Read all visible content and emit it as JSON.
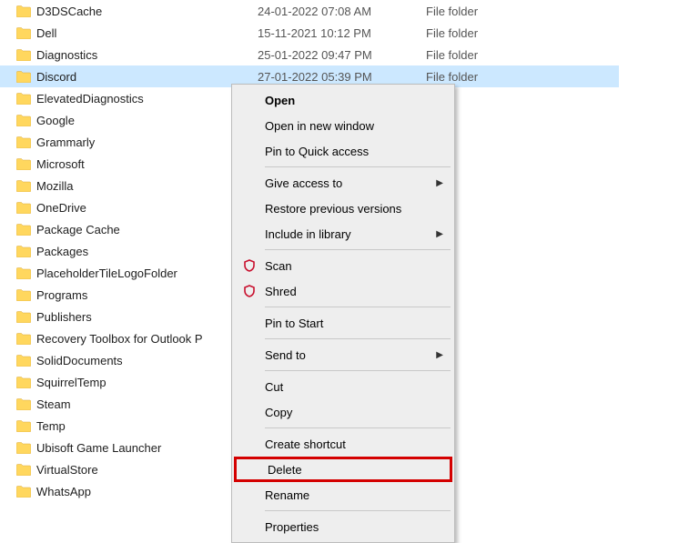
{
  "rows": [
    {
      "name": "D3DSCache",
      "date": "24-01-2022 07:08 AM",
      "type": "File folder",
      "selected": false
    },
    {
      "name": "Dell",
      "date": "15-11-2021 10:12 PM",
      "type": "File folder",
      "selected": false
    },
    {
      "name": "Diagnostics",
      "date": "25-01-2022 09:47 PM",
      "type": "File folder",
      "selected": false
    },
    {
      "name": "Discord",
      "date": "27-01-2022 05:39 PM",
      "type": "File folder",
      "selected": true
    },
    {
      "name": "ElevatedDiagnostics",
      "date": "",
      "type": "older",
      "selected": false
    },
    {
      "name": "Google",
      "date": "",
      "type": "older",
      "selected": false
    },
    {
      "name": "Grammarly",
      "date": "",
      "type": "older",
      "selected": false
    },
    {
      "name": "Microsoft",
      "date": "",
      "type": "older",
      "selected": false
    },
    {
      "name": "Mozilla",
      "date": "",
      "type": "older",
      "selected": false
    },
    {
      "name": "OneDrive",
      "date": "",
      "type": "older",
      "selected": false
    },
    {
      "name": "Package Cache",
      "date": "",
      "type": "older",
      "selected": false
    },
    {
      "name": "Packages",
      "date": "",
      "type": "older",
      "selected": false
    },
    {
      "name": "PlaceholderTileLogoFolder",
      "date": "",
      "type": "older",
      "selected": false
    },
    {
      "name": "Programs",
      "date": "",
      "type": "older",
      "selected": false
    },
    {
      "name": "Publishers",
      "date": "",
      "type": "older",
      "selected": false
    },
    {
      "name": "Recovery Toolbox for Outlook P",
      "date": "",
      "type": "older",
      "selected": false
    },
    {
      "name": "SolidDocuments",
      "date": "",
      "type": "older",
      "selected": false
    },
    {
      "name": "SquirrelTemp",
      "date": "",
      "type": "older",
      "selected": false
    },
    {
      "name": "Steam",
      "date": "",
      "type": "older",
      "selected": false
    },
    {
      "name": "Temp",
      "date": "",
      "type": "older",
      "selected": false
    },
    {
      "name": "Ubisoft Game Launcher",
      "date": "",
      "type": "older",
      "selected": false
    },
    {
      "name": "VirtualStore",
      "date": "",
      "type": "older",
      "selected": false
    },
    {
      "name": "WhatsApp",
      "date": "",
      "type": "older",
      "selected": false
    }
  ],
  "menu": {
    "open": "Open",
    "open_new_window": "Open in new window",
    "pin_quick_access": "Pin to Quick access",
    "give_access_to": "Give access to",
    "restore_previous": "Restore previous versions",
    "include_in_library": "Include in library",
    "scan": "Scan",
    "shred": "Shred",
    "pin_to_start": "Pin to Start",
    "send_to": "Send to",
    "cut": "Cut",
    "copy": "Copy",
    "create_shortcut": "Create shortcut",
    "delete": "Delete",
    "rename": "Rename",
    "properties": "Properties"
  }
}
